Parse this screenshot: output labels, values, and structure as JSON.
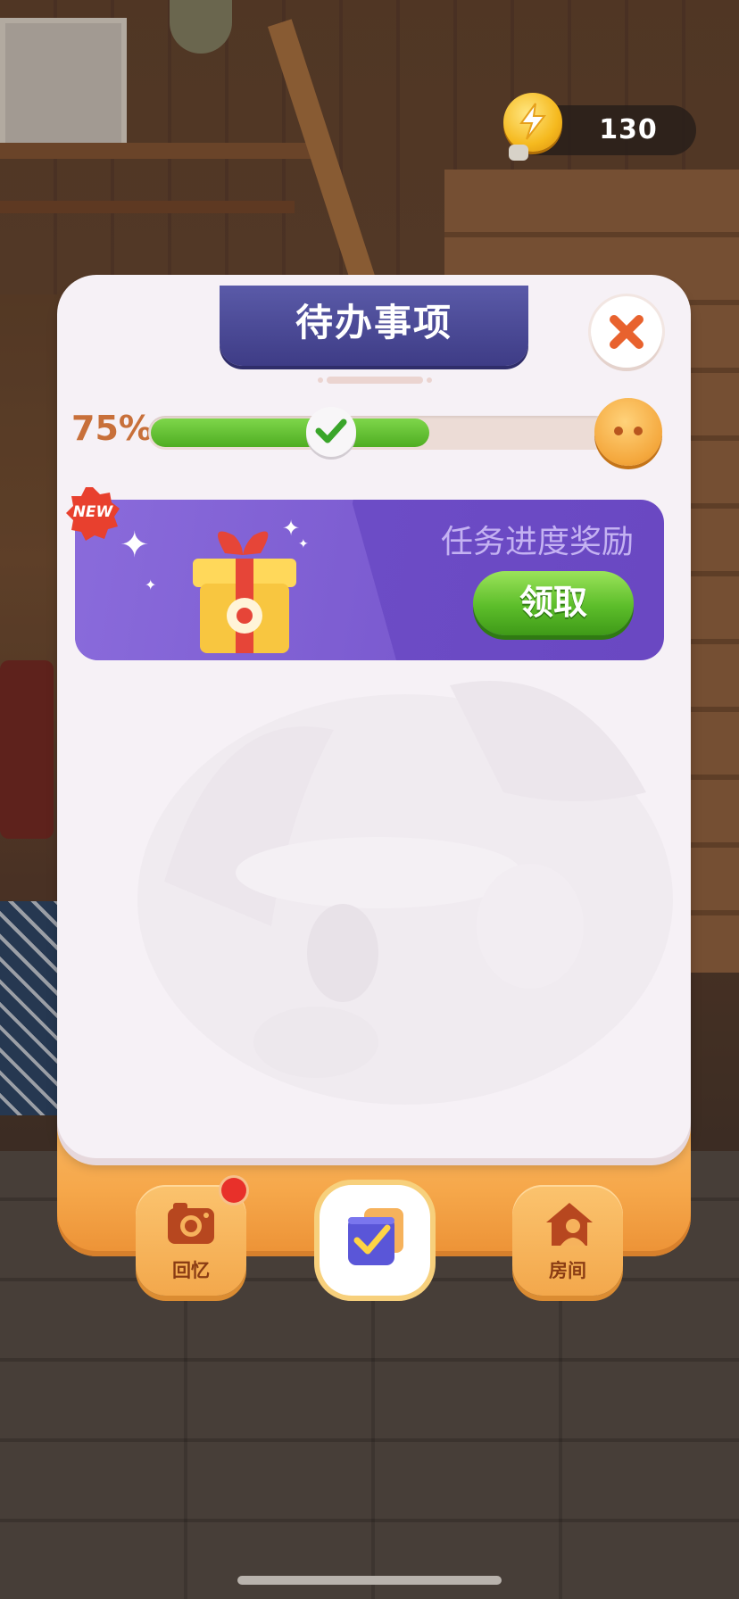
{
  "currency": {
    "icon": "energy-bolt-icon",
    "value": "130"
  },
  "panel": {
    "title": "待办事项",
    "progress": {
      "percent_label": "75%",
      "fill_fraction": 0.6,
      "marker_fraction": 0.34
    },
    "reward": {
      "badge": "NEW",
      "label": "任务进度奖励",
      "claim_button": "领取"
    }
  },
  "dock": {
    "items": [
      {
        "label": "回忆",
        "icon": "camera-icon",
        "has_notification": true
      },
      {
        "label": "",
        "icon": "todo-checklist-icon",
        "active": true
      },
      {
        "label": "房间",
        "icon": "house-person-icon"
      }
    ]
  },
  "colors": {
    "accent_purple": "#3e3c86",
    "progress_green": "#5cbd2a",
    "dock_orange": "#f6a84b",
    "reward_purple": "#7b5bd0"
  }
}
